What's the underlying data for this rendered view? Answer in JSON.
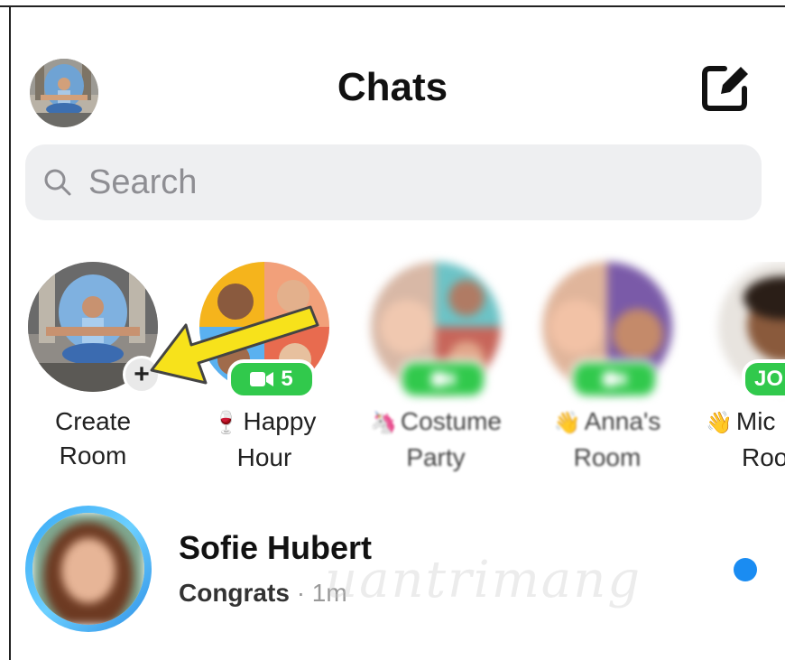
{
  "header": {
    "title": "Chats"
  },
  "search": {
    "placeholder": "Search"
  },
  "rooms": [
    {
      "line1": "Create",
      "line2": "Room",
      "emoji": ""
    },
    {
      "line1": "Happy",
      "line2": "Hour",
      "emoji": "🍷",
      "video_count": "5"
    },
    {
      "line1": "Costume",
      "line2": "Party",
      "emoji": "🦄"
    },
    {
      "line1": "Anna's",
      "line2": "Room",
      "emoji": "👋"
    },
    {
      "line1": "Mic",
      "line2": "Roo",
      "emoji": "👋",
      "badge": "JO"
    }
  ],
  "chat": {
    "name": "Sofie Hubert",
    "preview": "Congrats",
    "time": "· 1m"
  },
  "watermark": "uantrimang",
  "colors": {
    "accent": "#1a8cf2",
    "video_green": "#31c94c",
    "search_bg": "#eeeff1",
    "arrow_yellow": "#f7e21b"
  },
  "icons": [
    "compose-icon",
    "search-icon",
    "plus-icon",
    "video-icon"
  ]
}
